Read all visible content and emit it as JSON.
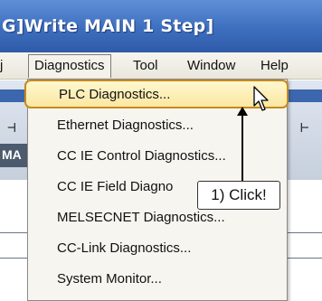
{
  "title_bar": {
    "title": "G]Write MAIN 1 Step]"
  },
  "menubar": {
    "items": [
      {
        "label": "j"
      },
      {
        "label": "Diagnostics"
      },
      {
        "label": "Tool"
      },
      {
        "label": "Window"
      },
      {
        "label": "Help"
      }
    ]
  },
  "background": {
    "tab_label": "MA"
  },
  "dropdown": {
    "items": [
      {
        "label": "PLC Diagnostics..."
      },
      {
        "label": "Ethernet Diagnostics..."
      },
      {
        "label": "CC IE Control Diagnostics..."
      },
      {
        "label": "CC IE Field Diagno"
      },
      {
        "label": "MELSECNET Diagnostics..."
      },
      {
        "label": "CC-Link Diagnostics..."
      },
      {
        "label": "System Monitor..."
      }
    ]
  },
  "annotation": {
    "text": "1) Click!"
  }
}
